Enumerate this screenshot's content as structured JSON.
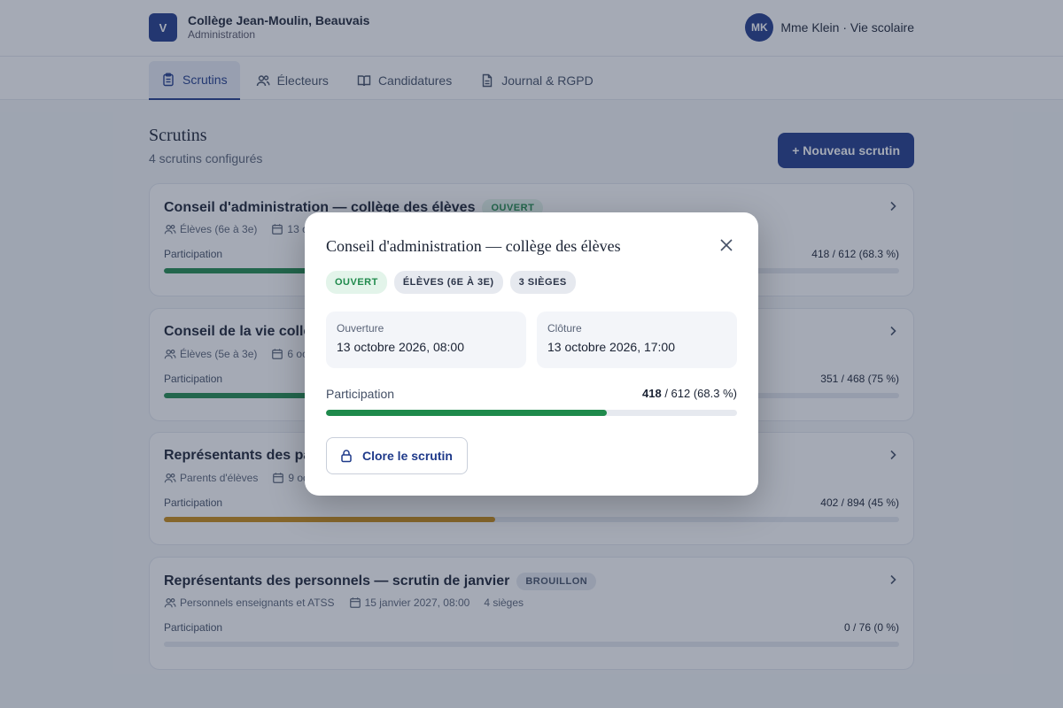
{
  "header": {
    "logo_letter": "V",
    "school_name": "Collège Jean-Moulin, Beauvais",
    "school_sub": "Administration",
    "avatar_initials": "MK",
    "user_name": "Mme Klein · Vie scolaire"
  },
  "tabs": [
    {
      "label": "Scrutins",
      "icon": "clipboard-icon",
      "active": true
    },
    {
      "label": "Électeurs",
      "icon": "users-icon",
      "active": false
    },
    {
      "label": "Candidatures",
      "icon": "book-icon",
      "active": false
    },
    {
      "label": "Journal & RGPD",
      "icon": "document-icon",
      "active": false
    }
  ],
  "page": {
    "title": "Scrutins",
    "subtitle": "4 scrutins configurés",
    "new_button": "+ Nouveau scrutin",
    "participation_label": "Participation"
  },
  "elections": [
    {
      "title": "Conseil d'administration — collège des élèves",
      "status": "OUVERT",
      "electorate": "Élèves (6e à 3e)",
      "date": "13 o",
      "seats": "",
      "participation_text": "418 / 612 (68.3 %)",
      "participation": 0.683,
      "bar_color": "#1f8a4c"
    },
    {
      "title": "Conseil de la vie colle",
      "status": "",
      "electorate": "Élèves (5e à 3e)",
      "date": "6 oc",
      "seats": "",
      "participation_text": "351 / 468 (75 %)",
      "participation": 0.75,
      "bar_color": "#1f8a4c"
    },
    {
      "title": "Représentants des pa",
      "status": "",
      "electorate": "Parents d'élèves",
      "date": "9 oc",
      "seats": "",
      "participation_text": "402 / 894 (45 %)",
      "participation": 0.45,
      "bar_color": "#c98a14"
    },
    {
      "title": "Représentants des personnels — scrutin de janvier",
      "status": "BROUILLON",
      "electorate": "Personnels enseignants et ATSS",
      "date": "15 janvier 2027, 08:00",
      "seats": "4 sièges",
      "participation_text": "0 / 76 (0 %)",
      "participation": 0,
      "bar_color": "#1f8a4c"
    }
  ],
  "modal": {
    "title": "Conseil d'administration — collège des élèves",
    "badges": [
      "OUVERT",
      "ÉLÈVES (6E À 3E)",
      "3 SIÈGES"
    ],
    "opening_label": "Ouverture",
    "opening_value": "13 octobre 2026, 08:00",
    "closing_label": "Clôture",
    "closing_value": "13 octobre 2026, 17:00",
    "participation_label": "Participation",
    "participation_count": "418",
    "participation_rest": " / 612 (68.3 %)",
    "participation": 0.683,
    "close_button": "Clore le scrutin"
  },
  "colors": {
    "primary": "#1f3a8a",
    "success": "#1f8a4c",
    "warning": "#c98a14"
  }
}
